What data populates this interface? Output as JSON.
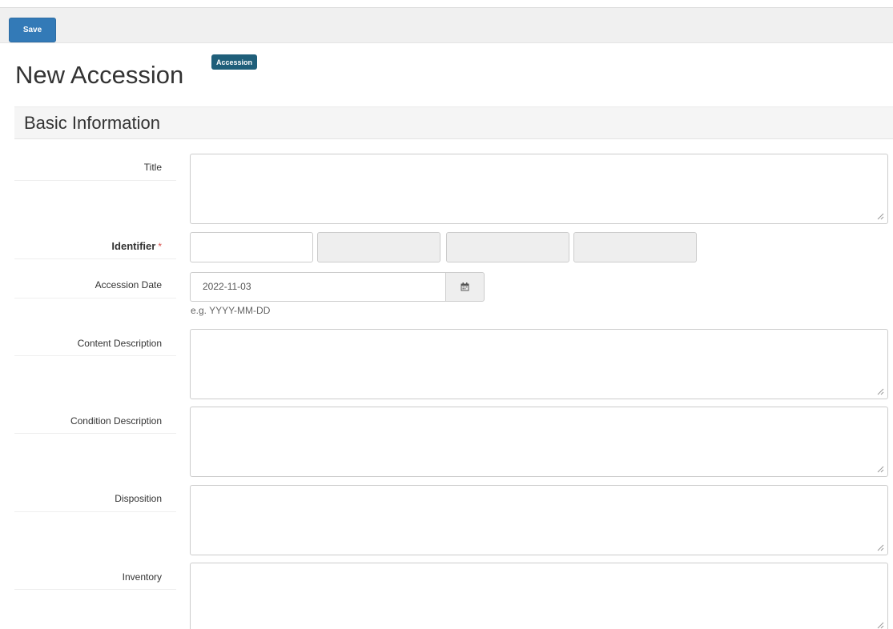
{
  "toolbar": {
    "save_label": "Save"
  },
  "header": {
    "title": "New Accession",
    "badge": "Accession"
  },
  "section": {
    "title": "Basic Information"
  },
  "fields": {
    "title": {
      "label": "Title",
      "value": ""
    },
    "identifier": {
      "label": "Identifier",
      "required_mark": "*",
      "parts": [
        "",
        "",
        "",
        ""
      ]
    },
    "accession_date": {
      "label": "Accession Date",
      "value": "2022-11-03",
      "help": "e.g. YYYY-MM-DD",
      "button_icon": "calendar-icon"
    },
    "content_description": {
      "label": "Content Description",
      "value": ""
    },
    "condition_description": {
      "label": "Condition Description",
      "value": ""
    },
    "disposition": {
      "label": "Disposition",
      "value": ""
    },
    "inventory": {
      "label": "Inventory",
      "value": ""
    }
  },
  "colors": {
    "primary": "#337ab7",
    "badge": "#1f5f7a",
    "required": "#d9534f",
    "section_bg": "#f5f5f5"
  }
}
